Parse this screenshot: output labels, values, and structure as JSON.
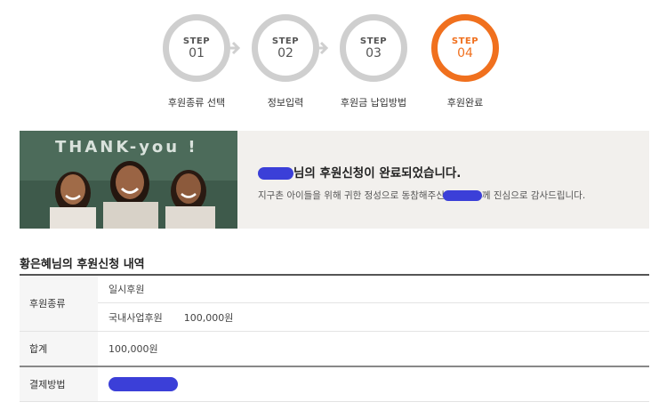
{
  "steps": [
    {
      "word": "STEP",
      "num": "01",
      "label": "후원종류 선택",
      "active": false
    },
    {
      "word": "STEP",
      "num": "02",
      "label": "정보입력",
      "active": false
    },
    {
      "word": "STEP",
      "num": "03",
      "label": "후원금 납입방법",
      "active": false
    },
    {
      "word": "STEP",
      "num": "04",
      "label": "후원완료",
      "active": true
    }
  ],
  "banner": {
    "main_suffix": "님의 후원신청이 완료되었습니다.",
    "sub_prefix": "지구촌 아이들을 위해 귀한 정성으로 동참해주신",
    "sub_suffix": "께 진심으로 감사드립니다.",
    "chalkboard_text": "THANK-you !"
  },
  "details": {
    "title": "황은혜님의 후원신청 내역",
    "type_label": "후원종류",
    "type_value": "일시후원",
    "program_name": "국내사업후원",
    "program_amount": "100,000원",
    "total_label": "합계",
    "total_value": "100,000원",
    "payment_label": "결제방법"
  },
  "colors": {
    "accent": "#f0701e",
    "inactive": "#cfcfcf",
    "redaction": "#3b3fd8"
  }
}
